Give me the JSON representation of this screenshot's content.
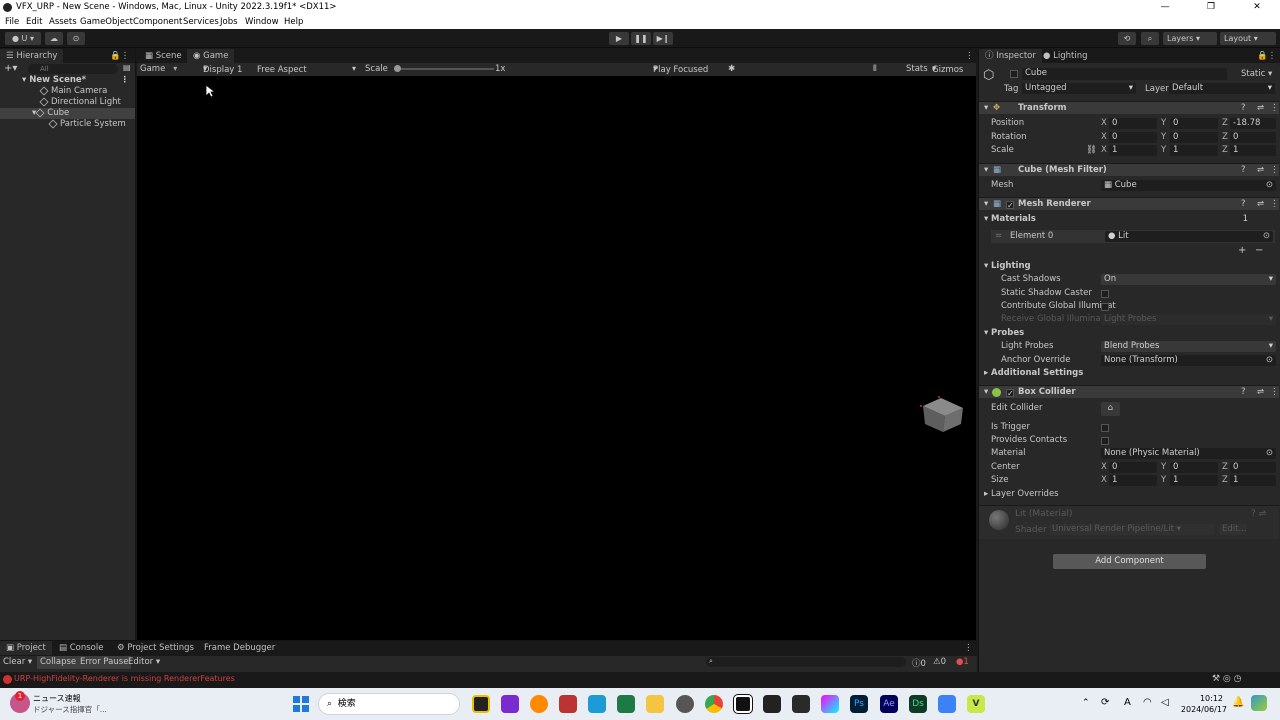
{
  "window": {
    "title": "VFX_URP - New Scene - Windows, Mac, Linux - Unity 2022.3.19f1* <DX11>",
    "controls": [
      "—",
      "❐",
      "✕"
    ]
  },
  "menu": [
    "File",
    "Edit",
    "Assets",
    "GameObject",
    "Component",
    "Services",
    "Jobs",
    "Window",
    "Help"
  ],
  "toolbar": {
    "account": "U",
    "layers": "Layers",
    "layout": "Layout"
  },
  "hierarchy": {
    "tab": "Hierarchy",
    "search_placeholder": "All",
    "items": [
      {
        "label": "New Scene*"
      },
      {
        "label": "Main Camera"
      },
      {
        "label": "Directional Light"
      },
      {
        "label": "Cube"
      },
      {
        "label": "Particle System"
      }
    ]
  },
  "gameview": {
    "tabs": [
      "Scene",
      "Game"
    ],
    "mode": "Game",
    "display": "Display 1",
    "aspect": "Free Aspect",
    "scale_label": "Scale",
    "scale_value": "1x",
    "play_mode": "Play Focused",
    "stats": "Stats",
    "gizmos": "Gizmos"
  },
  "inspector": {
    "tabs": [
      "Inspector",
      "Lighting"
    ],
    "object_name": "Cube",
    "static_label": "Static",
    "tag_label": "Tag",
    "tag_value": "Untagged",
    "layer_label": "Layer",
    "layer_value": "Default",
    "transform": {
      "title": "Transform",
      "position_label": "Position",
      "position": [
        "0",
        "0",
        "-18.78"
      ],
      "rotation_label": "Rotation",
      "rotation": [
        "0",
        "0",
        "0"
      ],
      "scale_label": "Scale",
      "scale": [
        "1",
        "1",
        "1"
      ]
    },
    "axes": [
      "X",
      "Y",
      "Z"
    ],
    "mesh_filter": {
      "title": "Cube (Mesh Filter)",
      "mesh_label": "Mesh",
      "mesh_value": "Cube"
    },
    "mesh_renderer": {
      "title": "Mesh Renderer",
      "materials_label": "Materials",
      "materials_count": "1",
      "element_label": "Element 0",
      "element_value": "Lit",
      "lighting_label": "Lighting",
      "cast_shadows_label": "Cast Shadows",
      "cast_shadows_value": "On",
      "static_shadow_label": "Static Shadow Caster",
      "contribute_gi_label": "Contribute Global Illuminat",
      "receive_gi_label": "Receive Global Illumination",
      "receive_gi_value": "Light Probes",
      "probes_label": "Probes",
      "light_probes_label": "Light Probes",
      "light_probes_value": "Blend Probes",
      "anchor_override_label": "Anchor Override",
      "anchor_override_value": "None (Transform)",
      "additional_settings_label": "Additional Settings"
    },
    "box_collider": {
      "title": "Box Collider",
      "edit_collider_label": "Edit Collider",
      "is_trigger_label": "Is Trigger",
      "provides_contacts_label": "Provides Contacts",
      "material_label": "Material",
      "material_value": "None (Physic Material)",
      "center_label": "Center",
      "center": [
        "0",
        "0",
        "0"
      ],
      "size_label": "Size",
      "size": [
        "1",
        "1",
        "1"
      ],
      "layer_overrides_label": "Layer Overrides"
    },
    "material_preview": {
      "name": "Lit (Material)",
      "shader_label": "Shader",
      "shader_value": "Universal Render Pipeline/Lit",
      "edit_label": "Edit..."
    },
    "add_component": "Add Component"
  },
  "bottom": {
    "tabs": [
      "Project",
      "Console",
      "Project Settings",
      "Frame Debugger"
    ],
    "console_buttons": [
      "Clear",
      "Collapse",
      "Error Pause",
      "Editor"
    ],
    "counts": [
      "0",
      "0",
      "1"
    ]
  },
  "status": {
    "message": "URP-HighFidelity-Renderer is missing RendererFeatures"
  },
  "taskbar": {
    "news_title": "ニュース速報",
    "news_sub": "ドジャース指揮官「...",
    "news_badge": "1",
    "search_label": "検索",
    "time": "10:12",
    "date": "2024/06/17",
    "ime": "A"
  }
}
